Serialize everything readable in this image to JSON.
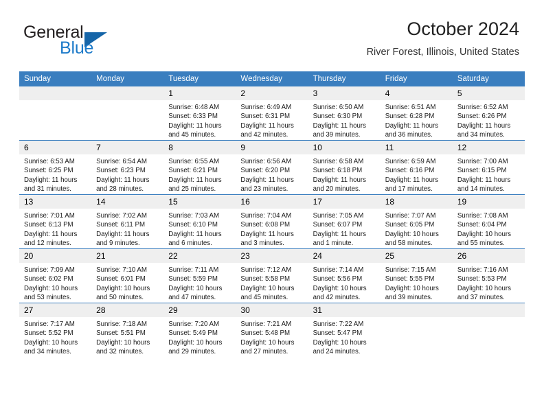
{
  "brand": {
    "name_top": "General",
    "name_bottom": "Blue",
    "accent_color": "#1c7ac9",
    "triangle_color": "#1565a8"
  },
  "header": {
    "title": "October 2024",
    "subtitle": "River Forest, Illinois, United States"
  },
  "theme": {
    "header_blue": "#3a7ebf",
    "daynum_band": "#efefef"
  },
  "weekday_headers": [
    "Sunday",
    "Monday",
    "Tuesday",
    "Wednesday",
    "Thursday",
    "Friday",
    "Saturday"
  ],
  "labels": {
    "sunrise_prefix": "Sunrise:",
    "sunset_prefix": "Sunset:",
    "daylight_prefix": "Daylight:"
  },
  "weeks": [
    [
      {
        "day": "",
        "sunrise": "",
        "sunset": "",
        "daylight_line1": "",
        "daylight_line2": "",
        "empty": true
      },
      {
        "day": "",
        "sunrise": "",
        "sunset": "",
        "daylight_line1": "",
        "daylight_line2": "",
        "empty": true
      },
      {
        "day": "1",
        "sunrise": "Sunrise: 6:48 AM",
        "sunset": "Sunset: 6:33 PM",
        "daylight_line1": "Daylight: 11 hours",
        "daylight_line2": "and 45 minutes."
      },
      {
        "day": "2",
        "sunrise": "Sunrise: 6:49 AM",
        "sunset": "Sunset: 6:31 PM",
        "daylight_line1": "Daylight: 11 hours",
        "daylight_line2": "and 42 minutes."
      },
      {
        "day": "3",
        "sunrise": "Sunrise: 6:50 AM",
        "sunset": "Sunset: 6:30 PM",
        "daylight_line1": "Daylight: 11 hours",
        "daylight_line2": "and 39 minutes."
      },
      {
        "day": "4",
        "sunrise": "Sunrise: 6:51 AM",
        "sunset": "Sunset: 6:28 PM",
        "daylight_line1": "Daylight: 11 hours",
        "daylight_line2": "and 36 minutes."
      },
      {
        "day": "5",
        "sunrise": "Sunrise: 6:52 AM",
        "sunset": "Sunset: 6:26 PM",
        "daylight_line1": "Daylight: 11 hours",
        "daylight_line2": "and 34 minutes."
      }
    ],
    [
      {
        "day": "6",
        "sunrise": "Sunrise: 6:53 AM",
        "sunset": "Sunset: 6:25 PM",
        "daylight_line1": "Daylight: 11 hours",
        "daylight_line2": "and 31 minutes."
      },
      {
        "day": "7",
        "sunrise": "Sunrise: 6:54 AM",
        "sunset": "Sunset: 6:23 PM",
        "daylight_line1": "Daylight: 11 hours",
        "daylight_line2": "and 28 minutes."
      },
      {
        "day": "8",
        "sunrise": "Sunrise: 6:55 AM",
        "sunset": "Sunset: 6:21 PM",
        "daylight_line1": "Daylight: 11 hours",
        "daylight_line2": "and 25 minutes."
      },
      {
        "day": "9",
        "sunrise": "Sunrise: 6:56 AM",
        "sunset": "Sunset: 6:20 PM",
        "daylight_line1": "Daylight: 11 hours",
        "daylight_line2": "and 23 minutes."
      },
      {
        "day": "10",
        "sunrise": "Sunrise: 6:58 AM",
        "sunset": "Sunset: 6:18 PM",
        "daylight_line1": "Daylight: 11 hours",
        "daylight_line2": "and 20 minutes."
      },
      {
        "day": "11",
        "sunrise": "Sunrise: 6:59 AM",
        "sunset": "Sunset: 6:16 PM",
        "daylight_line1": "Daylight: 11 hours",
        "daylight_line2": "and 17 minutes."
      },
      {
        "day": "12",
        "sunrise": "Sunrise: 7:00 AM",
        "sunset": "Sunset: 6:15 PM",
        "daylight_line1": "Daylight: 11 hours",
        "daylight_line2": "and 14 minutes."
      }
    ],
    [
      {
        "day": "13",
        "sunrise": "Sunrise: 7:01 AM",
        "sunset": "Sunset: 6:13 PM",
        "daylight_line1": "Daylight: 11 hours",
        "daylight_line2": "and 12 minutes."
      },
      {
        "day": "14",
        "sunrise": "Sunrise: 7:02 AM",
        "sunset": "Sunset: 6:11 PM",
        "daylight_line1": "Daylight: 11 hours",
        "daylight_line2": "and 9 minutes."
      },
      {
        "day": "15",
        "sunrise": "Sunrise: 7:03 AM",
        "sunset": "Sunset: 6:10 PM",
        "daylight_line1": "Daylight: 11 hours",
        "daylight_line2": "and 6 minutes."
      },
      {
        "day": "16",
        "sunrise": "Sunrise: 7:04 AM",
        "sunset": "Sunset: 6:08 PM",
        "daylight_line1": "Daylight: 11 hours",
        "daylight_line2": "and 3 minutes."
      },
      {
        "day": "17",
        "sunrise": "Sunrise: 7:05 AM",
        "sunset": "Sunset: 6:07 PM",
        "daylight_line1": "Daylight: 11 hours",
        "daylight_line2": "and 1 minute."
      },
      {
        "day": "18",
        "sunrise": "Sunrise: 7:07 AM",
        "sunset": "Sunset: 6:05 PM",
        "daylight_line1": "Daylight: 10 hours",
        "daylight_line2": "and 58 minutes."
      },
      {
        "day": "19",
        "sunrise": "Sunrise: 7:08 AM",
        "sunset": "Sunset: 6:04 PM",
        "daylight_line1": "Daylight: 10 hours",
        "daylight_line2": "and 55 minutes."
      }
    ],
    [
      {
        "day": "20",
        "sunrise": "Sunrise: 7:09 AM",
        "sunset": "Sunset: 6:02 PM",
        "daylight_line1": "Daylight: 10 hours",
        "daylight_line2": "and 53 minutes."
      },
      {
        "day": "21",
        "sunrise": "Sunrise: 7:10 AM",
        "sunset": "Sunset: 6:01 PM",
        "daylight_line1": "Daylight: 10 hours",
        "daylight_line2": "and 50 minutes."
      },
      {
        "day": "22",
        "sunrise": "Sunrise: 7:11 AM",
        "sunset": "Sunset: 5:59 PM",
        "daylight_line1": "Daylight: 10 hours",
        "daylight_line2": "and 47 minutes."
      },
      {
        "day": "23",
        "sunrise": "Sunrise: 7:12 AM",
        "sunset": "Sunset: 5:58 PM",
        "daylight_line1": "Daylight: 10 hours",
        "daylight_line2": "and 45 minutes."
      },
      {
        "day": "24",
        "sunrise": "Sunrise: 7:14 AM",
        "sunset": "Sunset: 5:56 PM",
        "daylight_line1": "Daylight: 10 hours",
        "daylight_line2": "and 42 minutes."
      },
      {
        "day": "25",
        "sunrise": "Sunrise: 7:15 AM",
        "sunset": "Sunset: 5:55 PM",
        "daylight_line1": "Daylight: 10 hours",
        "daylight_line2": "and 39 minutes."
      },
      {
        "day": "26",
        "sunrise": "Sunrise: 7:16 AM",
        "sunset": "Sunset: 5:53 PM",
        "daylight_line1": "Daylight: 10 hours",
        "daylight_line2": "and 37 minutes."
      }
    ],
    [
      {
        "day": "27",
        "sunrise": "Sunrise: 7:17 AM",
        "sunset": "Sunset: 5:52 PM",
        "daylight_line1": "Daylight: 10 hours",
        "daylight_line2": "and 34 minutes."
      },
      {
        "day": "28",
        "sunrise": "Sunrise: 7:18 AM",
        "sunset": "Sunset: 5:51 PM",
        "daylight_line1": "Daylight: 10 hours",
        "daylight_line2": "and 32 minutes."
      },
      {
        "day": "29",
        "sunrise": "Sunrise: 7:20 AM",
        "sunset": "Sunset: 5:49 PM",
        "daylight_line1": "Daylight: 10 hours",
        "daylight_line2": "and 29 minutes."
      },
      {
        "day": "30",
        "sunrise": "Sunrise: 7:21 AM",
        "sunset": "Sunset: 5:48 PM",
        "daylight_line1": "Daylight: 10 hours",
        "daylight_line2": "and 27 minutes."
      },
      {
        "day": "31",
        "sunrise": "Sunrise: 7:22 AM",
        "sunset": "Sunset: 5:47 PM",
        "daylight_line1": "Daylight: 10 hours",
        "daylight_line2": "and 24 minutes."
      },
      {
        "day": "",
        "sunrise": "",
        "sunset": "",
        "daylight_line1": "",
        "daylight_line2": "",
        "empty": true
      },
      {
        "day": "",
        "sunrise": "",
        "sunset": "",
        "daylight_line1": "",
        "daylight_line2": "",
        "empty": true
      }
    ]
  ]
}
